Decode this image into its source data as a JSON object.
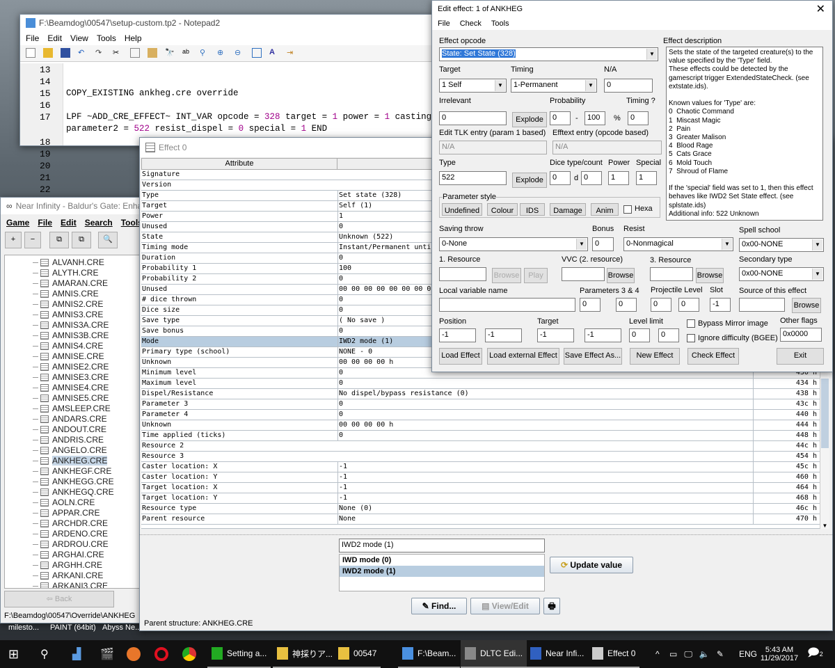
{
  "notepad": {
    "title": "F:\\Beamdog\\00547\\setup-custom.tp2 - Notepad2",
    "menu": [
      "File",
      "Edit",
      "View",
      "Tools",
      "Help"
    ],
    "lines": [
      {
        "n": "13",
        "t": ""
      },
      {
        "n": "14",
        "t": ""
      },
      {
        "n": "15",
        "t": "COPY_EXISTING ankheg.cre override"
      },
      {
        "n": "16",
        "t": ""
      },
      {
        "n": "17",
        "t": "LPF ~ADD_CRE_EFFECT~ INT_VAR opcode = 328 target = 1 power = 1 casting"
      },
      {
        "n": "",
        "t": "parameter2 = 522 resist_dispel = 0 special = 1 END"
      },
      {
        "n": "18",
        "t": ""
      },
      {
        "n": "19",
        "t": ""
      },
      {
        "n": "20",
        "t": ""
      },
      {
        "n": "21",
        "t": ""
      },
      {
        "n": "22",
        "t": ""
      }
    ]
  },
  "near_infinity": {
    "title": "Near Infinity - Baldur's Gate: Enhan",
    "menu": [
      "Game",
      "File",
      "Edit",
      "Search",
      "Tools"
    ],
    "tree": [
      "ALVANH.CRE",
      "ALYTH.CRE",
      "AMARAN.CRE",
      "AMNIS.CRE",
      "AMNIS2.CRE",
      "AMNIS3.CRE",
      "AMNIS3A.CRE",
      "AMNIS3B.CRE",
      "AMNIS4.CRE",
      "AMNISE.CRE",
      "AMNISE2.CRE",
      "AMNISE3.CRE",
      "AMNISE4.CRE",
      "AMNISE5.CRE",
      "AMSLEEP.CRE",
      "ANDARS.CRE",
      "ANDOUT.CRE",
      "ANDRIS.CRE",
      "ANGELO.CRE",
      "ANKHEG.CRE",
      "ANKHEGF.CRE",
      "ANKHEGG.CRE",
      "ANKHEGQ.CRE",
      "AOLN.CRE",
      "APPAR.CRE",
      "ARCHDR.CRE",
      "ARDENO.CRE",
      "ARDROU.CRE",
      "ARGHAI.CRE",
      "ARGHH.CRE",
      "ARKANI.CRE",
      "ARKANI3.CRE"
    ],
    "selected": "ANKHEG.CRE",
    "back": "Back",
    "status": "F:\\Beamdog\\00547\\Override\\ANKHEG"
  },
  "effect_window": {
    "title": "Effect 0",
    "col_attribute": "Attribute",
    "rows": [
      [
        "Signature",
        "",
        ""
      ],
      [
        "Version",
        "",
        ""
      ],
      [
        "Type",
        "Set state (328)",
        ""
      ],
      [
        "Target",
        "Self (1)",
        ""
      ],
      [
        "Power",
        "1",
        ""
      ],
      [
        "Unused",
        "0",
        ""
      ],
      [
        "State",
        "Unknown (522)",
        ""
      ],
      [
        "Timing mode",
        "Instant/Permanent until",
        ""
      ],
      [
        "Duration",
        "0",
        ""
      ],
      [
        "Probability 1",
        "100",
        ""
      ],
      [
        "Probability 2",
        "0",
        ""
      ],
      [
        "Unused",
        "00 00 00 00 00 00 00 00",
        ""
      ],
      [
        "# dice thrown",
        "0",
        ""
      ],
      [
        "Dice size",
        "0",
        ""
      ],
      [
        "Save type",
        "( No save )",
        ""
      ],
      [
        "Save bonus",
        "0",
        ""
      ],
      [
        "Mode",
        "IWD2 mode (1)",
        ""
      ],
      [
        "Primary type (school)",
        "NONE - 0",
        ""
      ],
      [
        "Unknown",
        "00 00 00 00 h",
        ""
      ],
      [
        "Minimum level",
        "0",
        "430 h"
      ],
      [
        "Maximum level",
        "0",
        "434 h"
      ],
      [
        "Dispel/Resistance",
        "No dispel/bypass resistance (0)",
        "438 h"
      ],
      [
        "Parameter 3",
        "0",
        "43c h"
      ],
      [
        "Parameter 4",
        "0",
        "440 h"
      ],
      [
        "Unknown",
        "00 00 00 00 h",
        "444 h"
      ],
      [
        "Time applied (ticks)",
        "0",
        "448 h"
      ],
      [
        "Resource 2",
        "",
        "44c h"
      ],
      [
        "Resource 3",
        "",
        "454 h"
      ],
      [
        "Caster location: X",
        "-1",
        "45c h"
      ],
      [
        "Caster location: Y",
        "-1",
        "460 h"
      ],
      [
        "Target location: X",
        "-1",
        "464 h"
      ],
      [
        "Target location: Y",
        "-1",
        "468 h"
      ],
      [
        "Resource type",
        "None (0)",
        "46c h"
      ],
      [
        "Parent resource",
        "None",
        "470 h"
      ]
    ],
    "selected_row": "Mode",
    "edit_value": "IWD2 mode (1)",
    "options": [
      "IWD mode (0)",
      "IWD2 mode (1)"
    ],
    "selected_option": "IWD2 mode (1)",
    "update_button": "Update value",
    "find_button": "Find...",
    "view_edit_button": "View/Edit",
    "status": "Parent structure: ANKHEG.CRE"
  },
  "edit_dialog": {
    "title": "Edit effect: 1 of ANKHEG",
    "menu": [
      "File",
      "Check",
      "Tools"
    ],
    "opcode_label": "Effect opcode",
    "opcode": "State: Set State (328)",
    "target_label": "Target",
    "target": "1 Self",
    "timing_label": "Timing",
    "timing": "1-Permanent",
    "na_label": "N/A",
    "na": "0",
    "irrelevant_label": "Irrelevant",
    "irrelevant": "0",
    "explode": "Explode",
    "probability_label": "Probability",
    "prob_min": "0",
    "prob_max": "100",
    "percent": "%",
    "timing2_label": "Timing ?",
    "timing2": "0",
    "tlk_label": "Edit TLK entry (param 1 based)",
    "tlk": "N/A",
    "efftext_label": "Efftext entry (opcode based)",
    "efftext": "N/A",
    "type_label": "Type",
    "type": "522",
    "dice_label": "Dice type/count",
    "dice_type": "0",
    "d": "d",
    "dice_count": "0",
    "power_label": "Power",
    "power": "1",
    "special_label": "Special",
    "special": "1",
    "param_style_label": "Parameter style",
    "param_styles": [
      "Undefined",
      "Colour",
      "IDS",
      "Damage",
      "Anim"
    ],
    "hexa": "Hexa",
    "desc_label": "Effect description",
    "description": "Sets the state of the targeted creature(s) to the value specified by the 'Type' field.\nThese effects could be detected by the gamescript trigger ExtendedStateCheck. (see extstate.ids).\n\nKnown values for 'Type' are:\n0  Chaotic Command\n1  Miscast Magic\n2  Pain\n3  Greater Malison\n4  Blood Rage\n5  Cats Grace\n6  Mold Touch\n7  Shroud of Flame\n\nIf the 'special' field was set to 1, then this effect behaves like IWD2 Set State effect. (see splstate.ids)\nAdditional info: 522 Unknown",
    "saving_label": "Saving throw",
    "saving": "0-None",
    "bonus_label": "Bonus",
    "bonus": "0",
    "resist_label": "Resist",
    "resist": "0-Nonmagical",
    "school_label": "Spell school",
    "school": "0x00-NONE",
    "res1_label": "1. Resource",
    "browse": "Browse",
    "play": "Play",
    "vvc_label": "VVC (2. resource)",
    "res3_label": "3. Resource",
    "secondary_label": "Secondary type",
    "secondary": "0x00-NONE",
    "localvar_label": "Local variable name",
    "params34_label": "Parameters 3 & 4",
    "param3": "0",
    "param4": "0",
    "projlevel_label": "Projectile Level",
    "projectile": "0",
    "level": "0",
    "slot_label": "Slot",
    "slot": "-1",
    "source_label": "Source of this effect",
    "position_label": "Position",
    "pos_x": "-1",
    "pos_y": "-1",
    "target_pos_label": "Target",
    "tgt_x": "-1",
    "tgt_y": "-1",
    "levellimit_label": "Level limit",
    "lvl_min": "0",
    "lvl_max": "0",
    "bypass_label": "Bypass Mirror image",
    "ignore_label": "Ignore difficulty (BGEE)",
    "otherflags_label": "Other flags",
    "otherflags": "0x0000",
    "buttons": [
      "Load Effect",
      "Load external Effect",
      "Save Effect As...",
      "New Effect",
      "Check Effect",
      "Exit"
    ]
  },
  "desktop": {
    "labels": [
      "milesto...",
      "PAINT (64bit)",
      "Abyss Ne..."
    ]
  },
  "taskbar": {
    "items": [
      "Setting a...",
      "神採りア...",
      "00547",
      "F:\\Beam...",
      "DLTC Edi...",
      "Near Infi...",
      "Effect 0"
    ],
    "lang": "ENG",
    "time": "5:43 AM",
    "date": "11/29/2017",
    "notifications": "2"
  }
}
